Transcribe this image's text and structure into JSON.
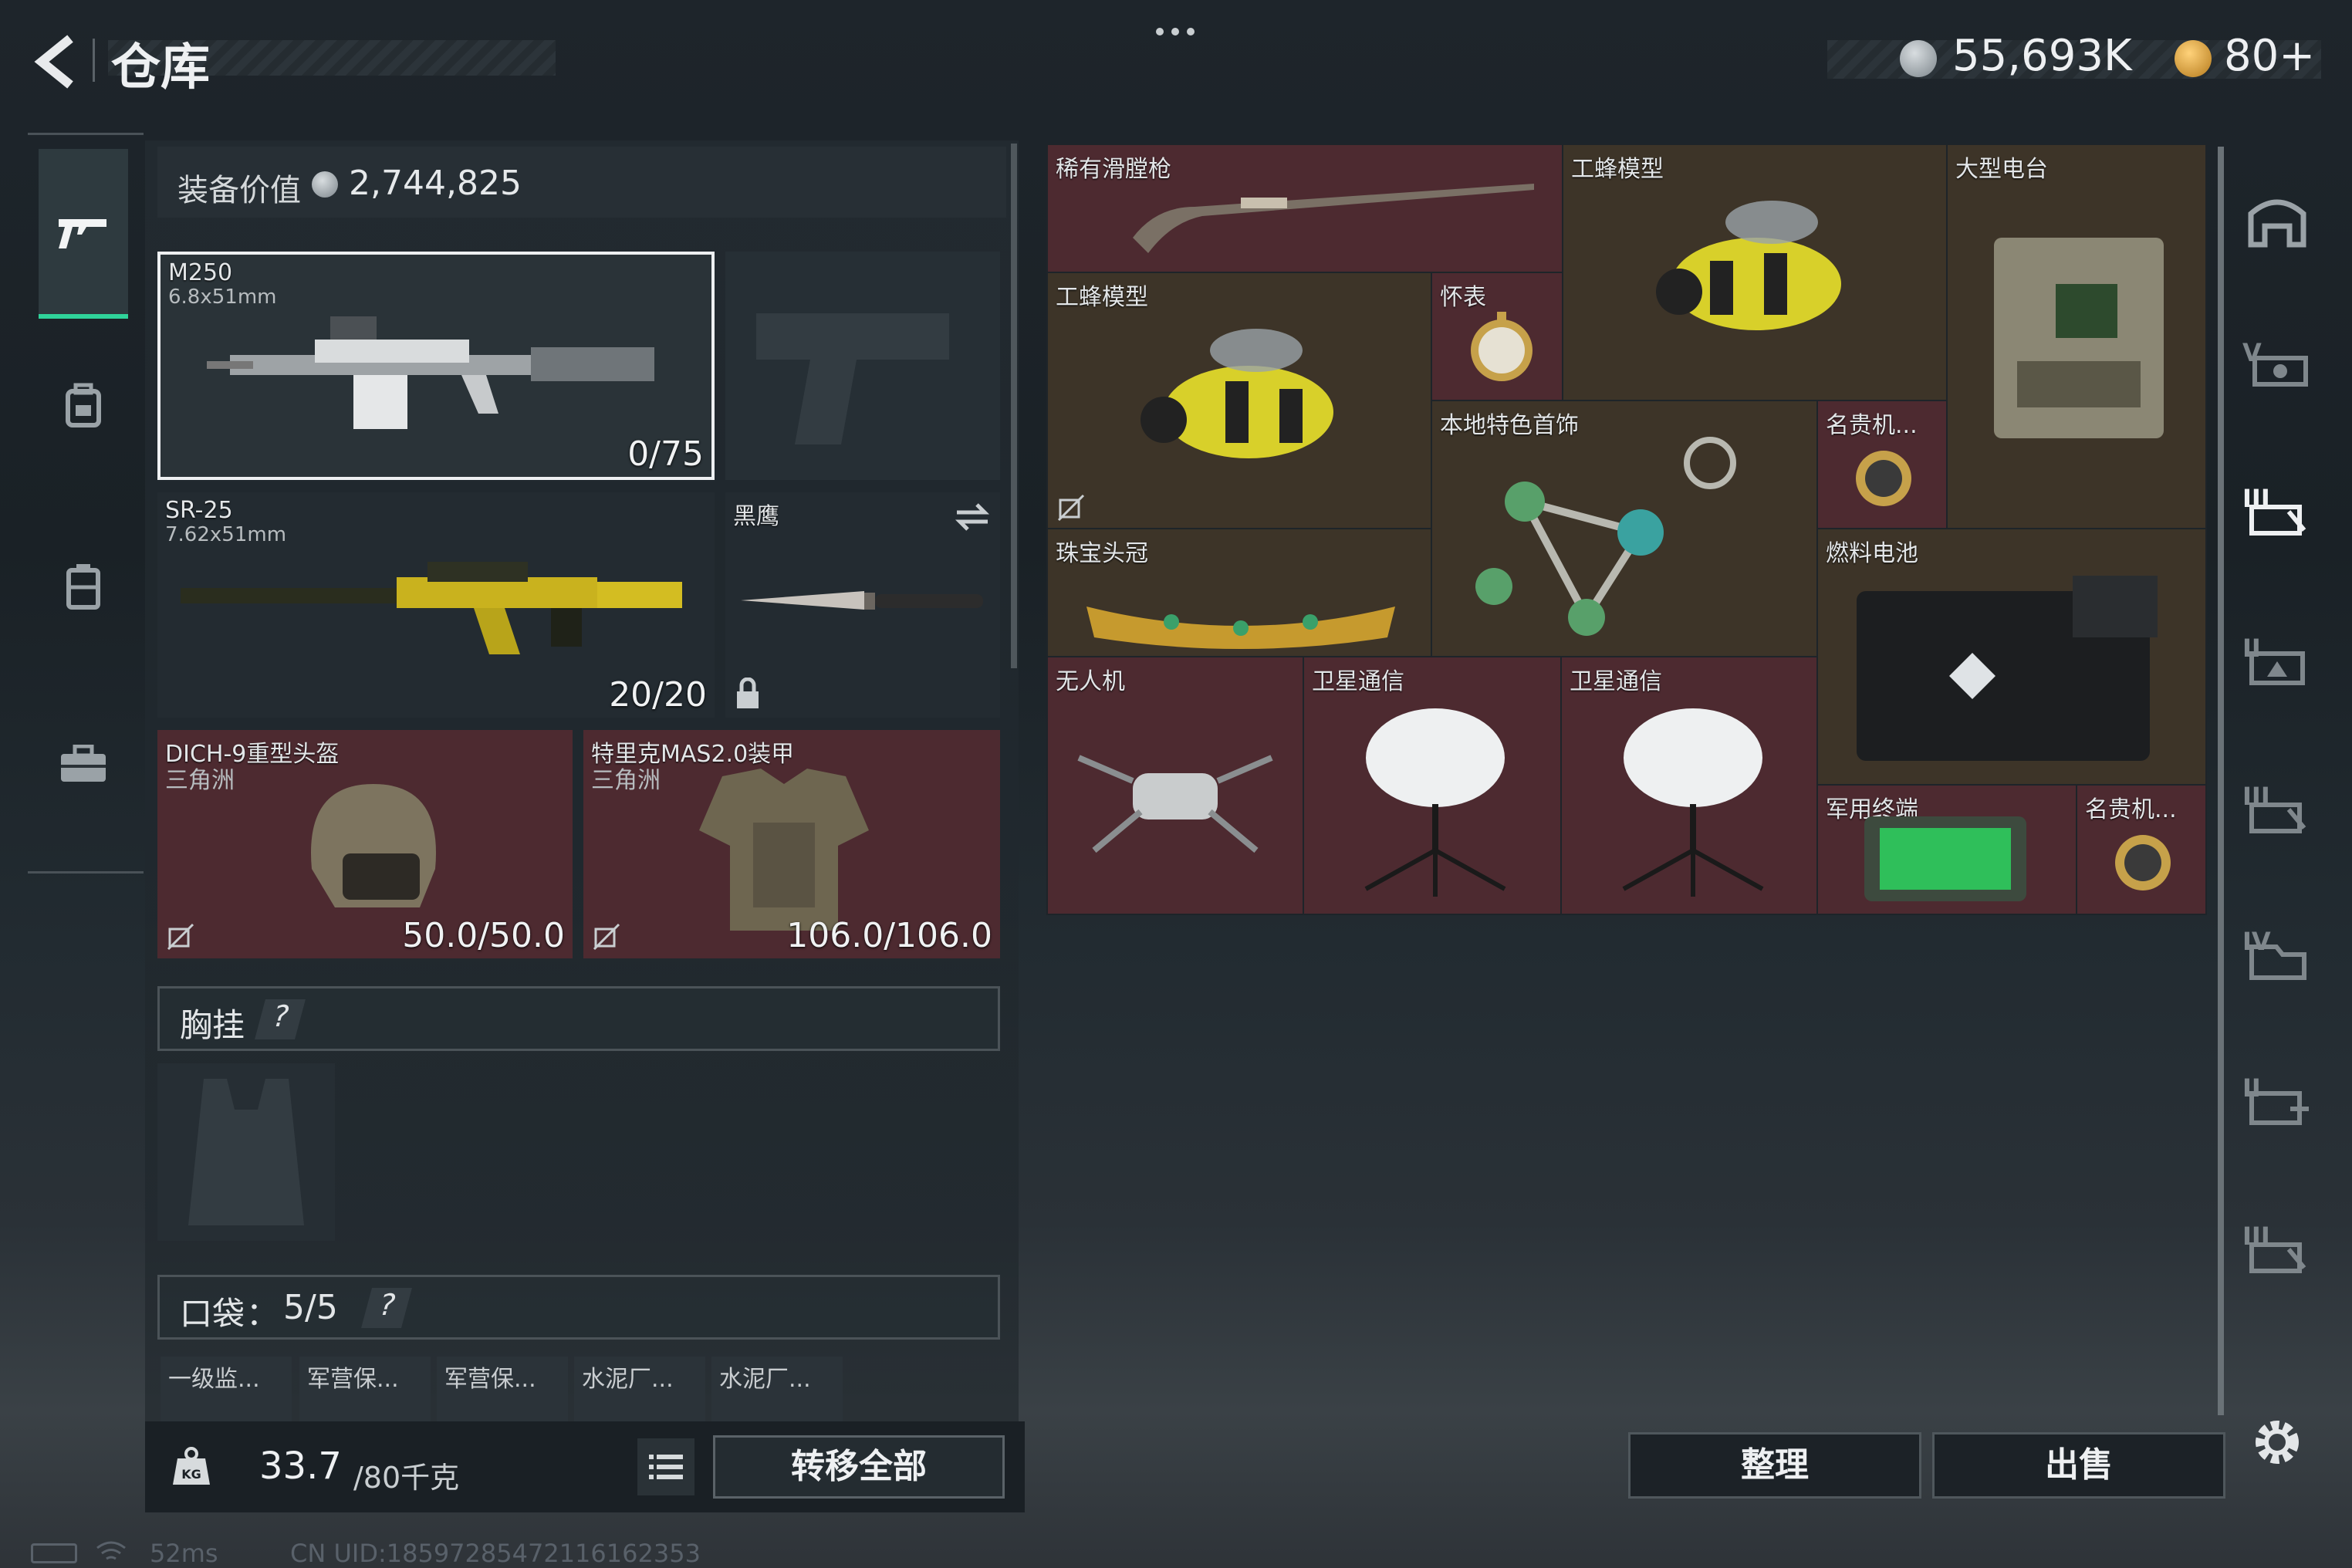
{
  "header": {
    "title": "仓库",
    "currency_amount": "55,693K",
    "coin_amount": "80+"
  },
  "loadout": {
    "value_label": "装备价值",
    "value": "2,744,825"
  },
  "weapons": [
    {
      "name": "M250",
      "caliber": "6.8x51mm",
      "ammo": "0/75"
    },
    {
      "name": "SR-25",
      "caliber": "7.62x51mm",
      "ammo": "20/20"
    },
    {
      "name": "黑鹰"
    }
  ],
  "armor": [
    {
      "name": "DICH-9重型头盔",
      "sub": "三角洲",
      "durability": "50.0/50.0"
    },
    {
      "name": "特里克MAS2.0装甲",
      "sub": "三角洲",
      "durability": "106.0/106.0"
    }
  ],
  "chest_rig": {
    "label": "胸挂",
    "help": "?"
  },
  "pockets": {
    "label": "口袋",
    "count": "5/5",
    "help": "?",
    "items": [
      "一级监...",
      "军营保...",
      "军营保...",
      "水泥厂...",
      "水泥厂..."
    ]
  },
  "footer": {
    "weight": "33.7",
    "weight_max": "/80千克",
    "transfer_all": "转移全部",
    "organize": "整理",
    "sell": "出售"
  },
  "status": {
    "ping": "52ms",
    "uid": "CN UID:18597285472116162353"
  },
  "inventory": [
    {
      "name": "稀有滑膛枪",
      "color": "red"
    },
    {
      "name": "工蜂模型",
      "color": "brown"
    },
    {
      "name": "大型电台",
      "color": "brown"
    },
    {
      "name": "工蜂模型",
      "color": "brown"
    },
    {
      "name": "怀表",
      "color": "red"
    },
    {
      "name": "本地特色首饰",
      "color": "brown"
    },
    {
      "name": "名贵机...",
      "color": "red"
    },
    {
      "name": "珠宝头冠",
      "color": "brown"
    },
    {
      "name": "燃料电池",
      "color": "brown"
    },
    {
      "name": "无人机",
      "color": "red"
    },
    {
      "name": "卫星通信",
      "color": "red"
    },
    {
      "name": "卫星通信",
      "color": "red"
    },
    {
      "name": "军用终端",
      "color": "red"
    },
    {
      "name": "名贵机...",
      "color": "red"
    }
  ]
}
